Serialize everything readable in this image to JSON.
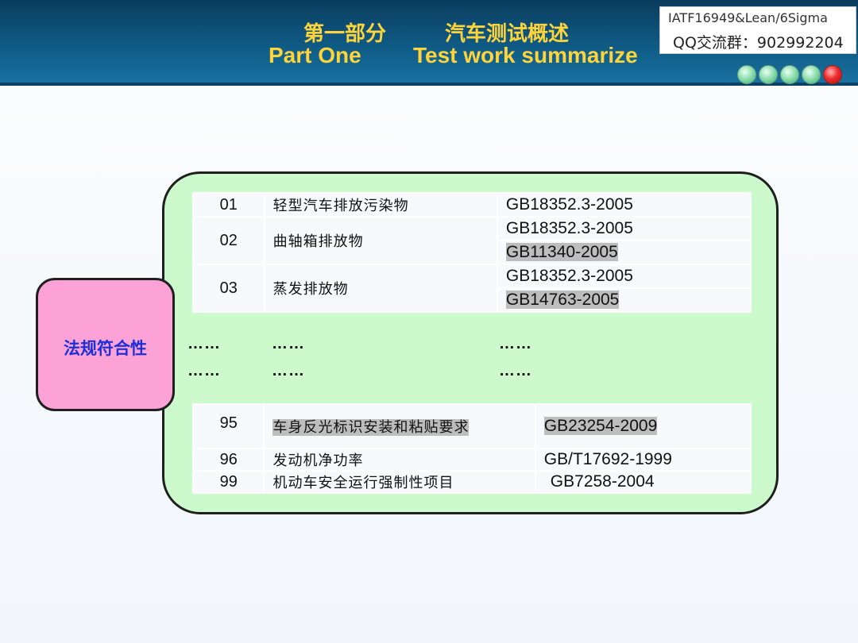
{
  "header": {
    "title_cn_part": "第一部分",
    "title_cn_topic": "汽车测试概述",
    "title_en_part": "Part One",
    "title_en_topic": "Test work summarize"
  },
  "badge": {
    "line1": "IATF16949&Lean/6Sigma",
    "line2": "QQ交流群：902992204"
  },
  "nav_dots": [
    "green",
    "green",
    "green",
    "green",
    "red"
  ],
  "category_label": "法规符合性",
  "table_top": {
    "rows": [
      {
        "num": "01",
        "name": "轻型汽车排放污染物",
        "standards": [
          "GB18352.3-2005"
        ]
      },
      {
        "num": "02",
        "name": "曲轴箱排放物",
        "standards": [
          "GB18352.3-2005",
          "GB11340-2005"
        ]
      },
      {
        "num": "03",
        "name": "蒸发排放物",
        "standards": [
          "GB18352.3-2005",
          "GB14763-2005"
        ]
      }
    ]
  },
  "ellipsis": "……",
  "table_bottom": {
    "rows": [
      {
        "num": "95",
        "name": "车身反光标识安装和粘贴要求",
        "standard": "GB23254-2009"
      },
      {
        "num": "96",
        "name": "发动机净功率",
        "standard": "GB/T17692-1999"
      },
      {
        "num": "99",
        "name": "机动车安全运行强制性项目",
        "standard": "GB7258-2004"
      }
    ]
  },
  "colors": {
    "header_bg": "#0f5b86",
    "title_text": "#ffd43a",
    "green_panel": "#ccfacc",
    "pink_panel": "#fca2d6",
    "label_text": "#1d2fd8",
    "highlight": "#bdbdbd"
  }
}
